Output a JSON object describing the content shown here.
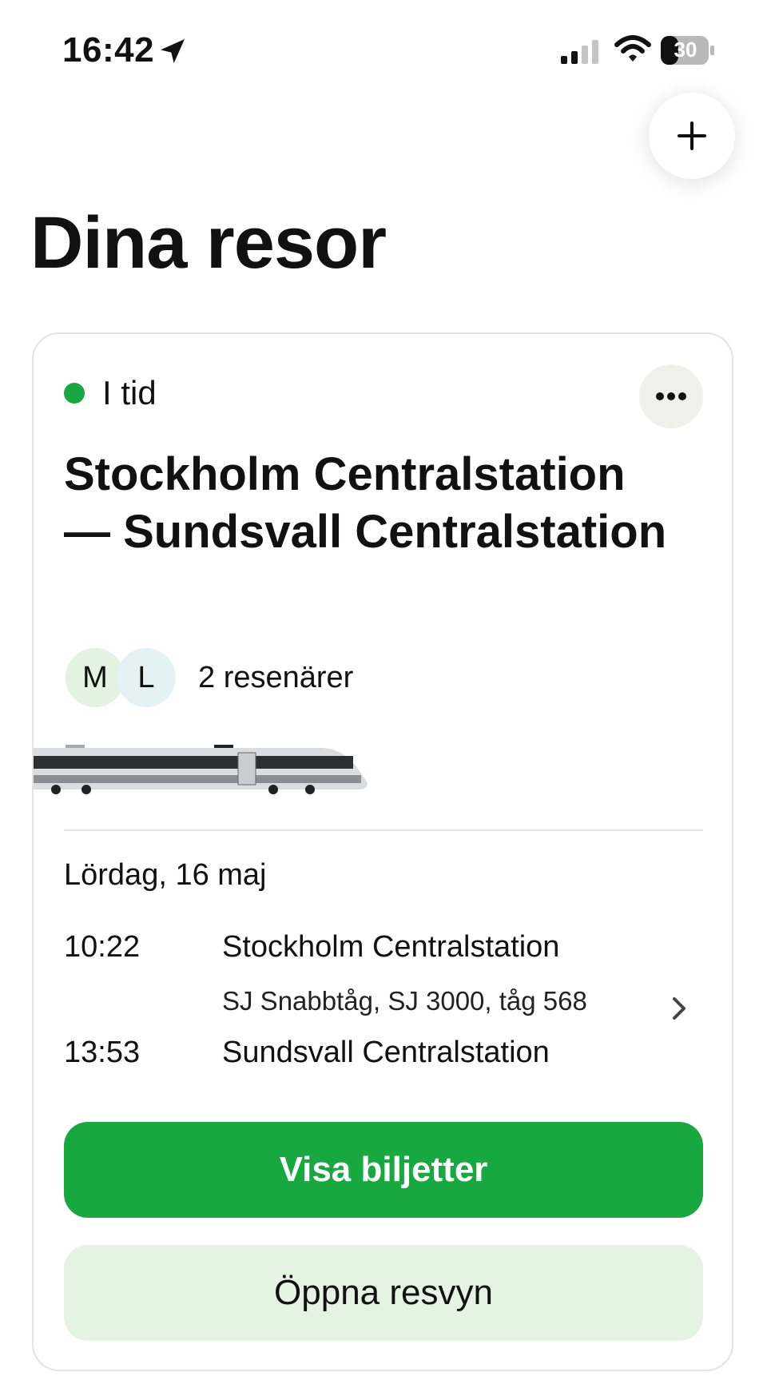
{
  "status_bar": {
    "time": "16:42",
    "battery": "30",
    "icons": [
      "location-arrow-icon",
      "signal-icon",
      "wifi-icon",
      "battery-icon"
    ]
  },
  "header": {
    "title": "Dina resor",
    "add_icon": "plus-icon"
  },
  "trip": {
    "status": "I tid",
    "status_color": "#17a83f",
    "route_title": "Stockholm Centralstation— Sundsvall Centralstation",
    "travelers": {
      "avatars": [
        "M",
        "L"
      ],
      "label": "2 resenärer"
    },
    "date": "Lördag, 16 maj",
    "departure": {
      "time": "10:22",
      "station": "Stockholm Centralstation"
    },
    "train_info": "SJ Snabbtåg, SJ 3000, tåg 568",
    "arrival": {
      "time": "13:53",
      "station": "Sundsvall Centralstation"
    },
    "primary_button": "Visa biljetter",
    "secondary_button": "Öppna resvyn"
  },
  "colors": {
    "accent": "#17a83f",
    "secondary_button_bg": "#e4f3e2",
    "more_button_bg": "#f1f1ec"
  }
}
